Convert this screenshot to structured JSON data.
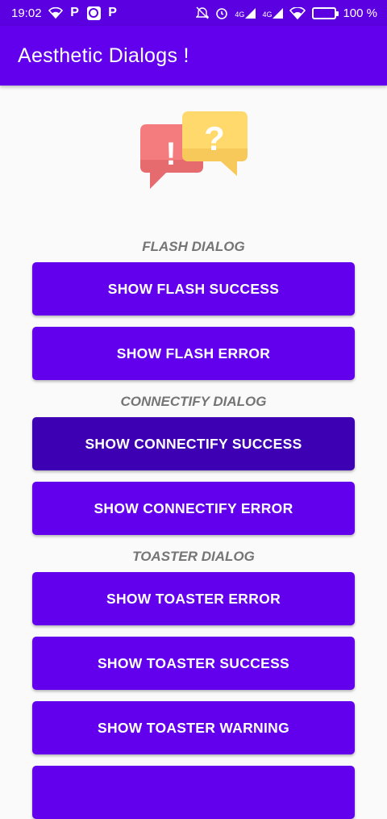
{
  "status_bar": {
    "time": "19:02",
    "battery_text": "100 %",
    "net_label_1": "4G",
    "net_label_2": "4G"
  },
  "app_bar": {
    "title": "Aesthetic Dialogs !"
  },
  "colors": {
    "primary": "#6200ee",
    "pressed": "#3d00b3",
    "status_bar": "#5b00e0",
    "label": "#757575"
  },
  "sections": {
    "flash": {
      "label": "FLASH DIALOG",
      "buttons": [
        "SHOW FLASH SUCCESS",
        "SHOW FLASH ERROR"
      ]
    },
    "connectify": {
      "label": "CONNECTIFY DIALOG",
      "buttons": [
        "SHOW CONNECTIFY SUCCESS",
        "SHOW CONNECTIFY ERROR"
      ]
    },
    "toaster": {
      "label": "TOASTER DIALOG",
      "buttons": [
        "SHOW TOASTER ERROR",
        "SHOW TOASTER SUCCESS",
        "SHOW TOASTER WARNING"
      ]
    }
  },
  "logo": {
    "left_glyph": "!",
    "right_glyph": "?"
  }
}
